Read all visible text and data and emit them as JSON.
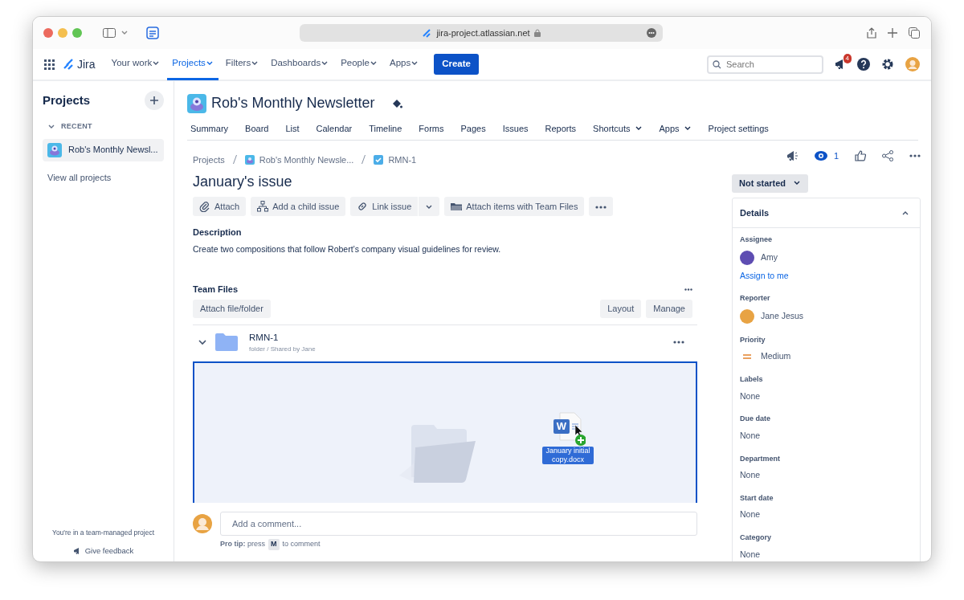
{
  "browser": {
    "url": "jira-project.atlassian.net"
  },
  "topnav": {
    "product": "Jira",
    "items": [
      {
        "label": "Your work",
        "selected": false
      },
      {
        "label": "Projects",
        "selected": true
      },
      {
        "label": "Filters",
        "selected": false
      },
      {
        "label": "Dashboards",
        "selected": false
      },
      {
        "label": "People",
        "selected": false
      },
      {
        "label": "Apps",
        "selected": false
      }
    ],
    "create": "Create",
    "search": {
      "placeholder": "Search"
    },
    "notifications": "4"
  },
  "sidebar": {
    "title": "Projects",
    "section": "RECENT",
    "projects": [
      {
        "name": "Rob's Monthly Newsl...",
        "selected": true
      }
    ],
    "view_all": "View all projects",
    "footer": "You're in a team-managed project",
    "feedback": "Give feedback"
  },
  "project": {
    "title": "Rob's Monthly Newsletter",
    "tabs": [
      {
        "label": "Summary",
        "dropdown": false
      },
      {
        "label": "Board",
        "dropdown": false
      },
      {
        "label": "List",
        "dropdown": false
      },
      {
        "label": "Calendar",
        "dropdown": false
      },
      {
        "label": "Timeline",
        "dropdown": false
      },
      {
        "label": "Forms",
        "dropdown": false
      },
      {
        "label": "Pages",
        "dropdown": false
      },
      {
        "label": "Issues",
        "dropdown": false
      },
      {
        "label": "Reports",
        "dropdown": false
      },
      {
        "label": "Shortcuts",
        "dropdown": true
      },
      {
        "label": "Apps",
        "dropdown": true
      },
      {
        "label": "Project settings",
        "dropdown": false
      }
    ]
  },
  "breadcrumbs": [
    "Projects",
    "Rob's Monthly Newsle...",
    "RMN-1"
  ],
  "issue": {
    "title": "January's issue",
    "actions": [
      {
        "label": "Attach",
        "kind": "attach"
      },
      {
        "label": "Add a child issue",
        "kind": "child"
      },
      {
        "label": "Link issue",
        "kind": "link"
      },
      {
        "label": "Attach items with Team Files",
        "kind": "files"
      }
    ],
    "description_label": "Description",
    "description": "Create two compositions that follow Robert’s company visual guidelines for review."
  },
  "team_files": {
    "title": "Team Files",
    "attach": "Attach file/folder",
    "layout": "Layout",
    "manage": "Manage",
    "folder": {
      "name": "RMN-1",
      "meta": "folder / Shared by Jane",
      "expanded": true
    },
    "dragged_file": "January initial copy.docx",
    "file_icon_letter": "W"
  },
  "comment": {
    "placeholder": "Add a comment...",
    "tip": "**Pro tip:** press",
    "key": "M",
    "tip_end": "to comment"
  },
  "watchers": "1",
  "status": "Not started",
  "details": {
    "title": "Details",
    "expanded": true,
    "fields": [
      {
        "label": "Assignee",
        "value": "Amy",
        "kind": "person",
        "color": "#5e4db2",
        "link": "Assign to me"
      },
      {
        "label": "Reporter",
        "value": "Jane Jesus",
        "kind": "person",
        "color": "#e8a343"
      },
      {
        "label": "Priority",
        "value": "Medium",
        "kind": "priority"
      },
      {
        "label": "Labels",
        "value": "None",
        "kind": "text"
      },
      {
        "label": "Due date",
        "value": "None",
        "kind": "text"
      },
      {
        "label": "Department",
        "value": "None",
        "kind": "text"
      },
      {
        "label": "Start date",
        "value": "None",
        "kind": "text"
      },
      {
        "label": "Category",
        "value": "None",
        "kind": "text"
      }
    ]
  }
}
